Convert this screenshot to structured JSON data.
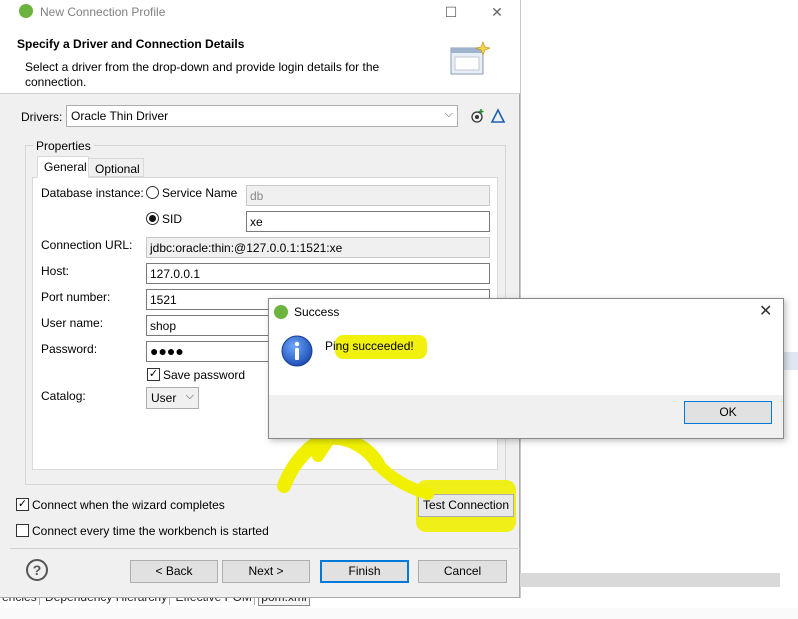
{
  "dialog": {
    "title": "New Connection Profile",
    "header_title": "Specify a Driver and Connection Details",
    "header_desc": "Select a driver from the drop-down and provide login details for the connection.",
    "drivers_label": "Drivers:",
    "driver_value": "Oracle Thin Driver",
    "properties_label": "Properties",
    "tabs": [
      "General",
      "Optional"
    ],
    "db_instance_label": "Database instance:",
    "service_name_label": "Service Name",
    "service_name_value": "db",
    "sid_label": "SID",
    "sid_value": "xe",
    "connection_url_label": "Connection URL:",
    "connection_url_value": "jdbc:oracle:thin:@127.0.0.1:1521:xe",
    "host_label": "Host:",
    "host_value": "127.0.0.1",
    "port_label": "Port number:",
    "port_value": "1521",
    "username_label": "User name:",
    "username_value": "shop",
    "password_label": "Password:",
    "password_value": "●●●●",
    "save_password_label": "Save password",
    "catalog_label": "Catalog:",
    "catalog_value": "User",
    "connect_wizard_label": "Connect when the wizard completes",
    "connect_every_label": "Connect every time the workbench is started",
    "test_connection_label": "Test Connection",
    "back_label": "< Back",
    "next_label": "Next >",
    "finish_label": "Finish",
    "cancel_label": "Cancel"
  },
  "popup": {
    "title": "Success",
    "message": "Ping succeeded!",
    "ok_label": "OK"
  },
  "background_tabs": [
    "encies",
    "Dependency Hierarchy",
    "Effective POM",
    "pom.xml"
  ],
  "colors": {
    "highlight": "#f0f000",
    "accent": "#0078d7",
    "spring_green": "#6db33f"
  }
}
